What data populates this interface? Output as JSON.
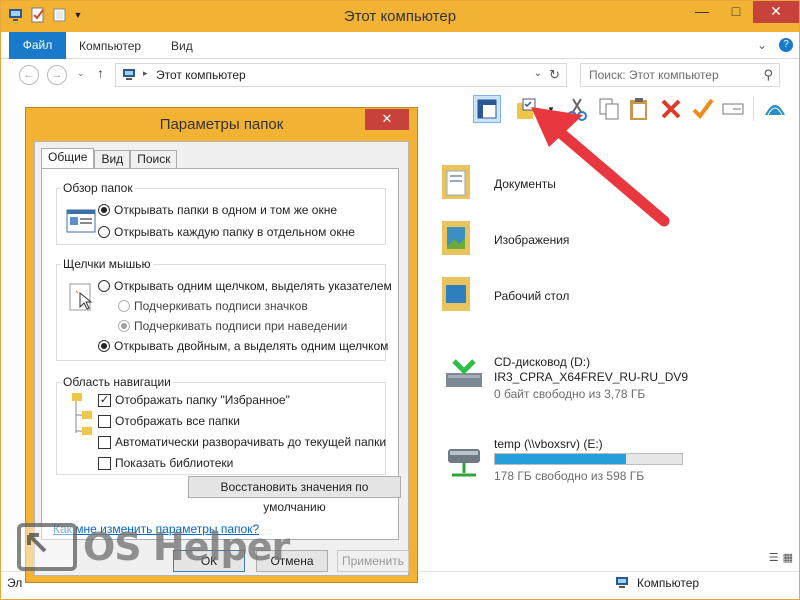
{
  "window": {
    "title": "Этот компьютер"
  },
  "ribbon": {
    "tabs": [
      "Файл",
      "Компьютер",
      "Вид"
    ]
  },
  "address": {
    "path": "Этот компьютер",
    "search_placeholder": "Поиск: Этот компьютер"
  },
  "content": {
    "folders": [
      "Документы",
      "Изображения",
      "Рабочий стол"
    ],
    "cd_drive": {
      "name": "CD-дисковод (D:)",
      "label": "IR3_CPRA_X64FREV_RU-RU_DV9",
      "info": "0 байт свободно из 3,78 ГБ"
    },
    "net_drive": {
      "name": "temp (\\\\vboxsrv) (E:)",
      "info": "178 ГБ свободно из 598 ГБ",
      "used_fraction": 0.7
    }
  },
  "status": {
    "left": "Эл",
    "location": "Компьютер"
  },
  "dialog": {
    "title": "Параметры папок",
    "tabs": [
      "Общие",
      "Вид",
      "Поиск"
    ],
    "browse": {
      "legend": "Обзор папок",
      "opt1": "Открывать папки в одном и том же окне",
      "opt2": "Открывать каждую папку в отдельном окне"
    },
    "clicks": {
      "legend": "Щелчки мышью",
      "opt1": "Открывать одним щелчком, выделять указателем",
      "sub1": "Подчеркивать подписи значков",
      "sub2": "Подчеркивать подписи при наведении",
      "opt2": "Открывать двойным, а выделять одним щелчком"
    },
    "nav": {
      "legend": "Область навигации",
      "c1": "Отображать папку \"Избранное\"",
      "c2": "Отображать все папки",
      "c3": "Автоматически разворачивать до текущей папки",
      "c4": "Показать библиотеки"
    },
    "restore": "Восстановить значения по умолчанию",
    "help_link": "Как мне изменить параметры папок?",
    "ok": "ОК",
    "cancel": "Отмена",
    "apply": "Применить"
  },
  "watermark": "OS Helper",
  "colors": {
    "accent": "#f2b335",
    "file_tab": "#1979ca",
    "progress": "#26a0da",
    "arrow": "#e8373e"
  }
}
